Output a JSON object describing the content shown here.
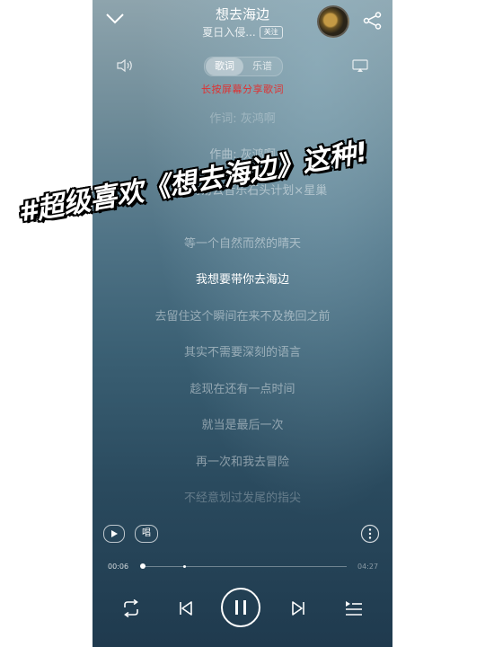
{
  "header": {
    "title": "想去海边",
    "artist": "夏日入侵...",
    "follow_label": "关注"
  },
  "tabs": {
    "lyrics": "歌词",
    "sheet": "乐谱"
  },
  "share_hint": "长按屏幕分享歌词",
  "lyrics": [
    "作词: 灰鸿啊",
    "作曲: 灰鸿啊",
    "出品: 网易云音乐石头计划×星巢",
    "等一个自然而然的晴天",
    "我想要带你去海边",
    "去留住这个瞬间在来不及挽回之前",
    "其实不需要深刻的语言",
    "趁现在还有一点时间",
    "就当是最后一次",
    "再一次和我去冒险",
    "不经意划过发尾的指尖"
  ],
  "current_lyric_index": 4,
  "controls": {
    "sing_label": "唱",
    "time_elapsed": "00:06",
    "time_total": "04:27",
    "progress_fraction": 0.02
  },
  "overlay_text": "#超级喜欢《想去海边》这种!",
  "colors": {
    "hint_red": "#e03030",
    "background_top": "#8ea4ad",
    "background_bottom": "#1f3a4e"
  },
  "icons": {
    "collapse": "chevron-down-icon",
    "share": "share-icon",
    "volume": "volume-icon",
    "cast": "cast-icon",
    "video": "video-play-icon",
    "more": "more-icon",
    "repeat": "repeat-icon",
    "prev": "previous-track-icon",
    "pause": "pause-icon",
    "next": "next-track-icon",
    "playlist": "playlist-icon"
  }
}
